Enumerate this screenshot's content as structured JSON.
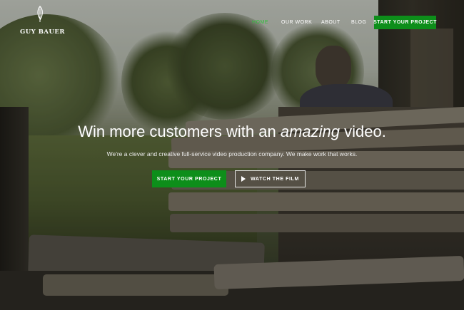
{
  "brand": {
    "name": "GUY BAUER",
    "logo_icon": "feather-icon"
  },
  "nav": {
    "items": [
      {
        "label": "HOME",
        "active": true
      },
      {
        "label": "OUR WORK",
        "active": false
      },
      {
        "label": "ABOUT",
        "active": false
      },
      {
        "label": "BLOG",
        "active": false
      }
    ],
    "cta_label": "START YOUR PROJECT"
  },
  "hero": {
    "headline_before": "Win more customers with an ",
    "headline_emphasis": "amazing",
    "headline_after": " video.",
    "subheadline": "We're a clever and creative full-service video production company.  We make work that works.",
    "primary_button": "START YOUR PROJECT",
    "secondary_button": "WATCH THE FILM",
    "secondary_icon": "play-icon"
  },
  "colors": {
    "accent": "#0d8e1a",
    "active_nav": "#2fbf3a",
    "text": "#ffffff"
  }
}
